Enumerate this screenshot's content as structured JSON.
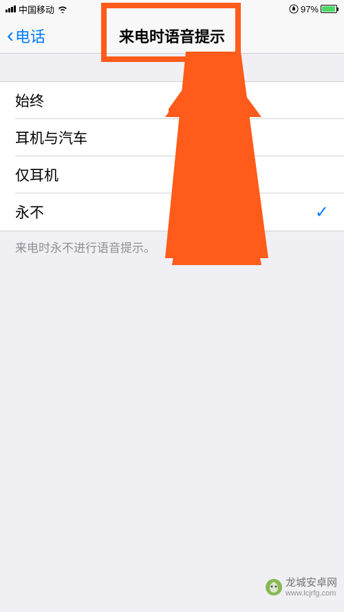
{
  "status": {
    "carrier": "中国移动",
    "battery_percent": "97%"
  },
  "nav": {
    "back_label": "电话",
    "title": "来电时语音提示"
  },
  "options": [
    {
      "label": "始终",
      "selected": false
    },
    {
      "label": "耳机与汽车",
      "selected": false
    },
    {
      "label": "仅耳机",
      "selected": false
    },
    {
      "label": "永不",
      "selected": true
    }
  ],
  "footer_note": "来电时永不进行语音提示。",
  "watermark": {
    "title": "龙城安卓网",
    "url": "www.lcjrfg.com"
  }
}
